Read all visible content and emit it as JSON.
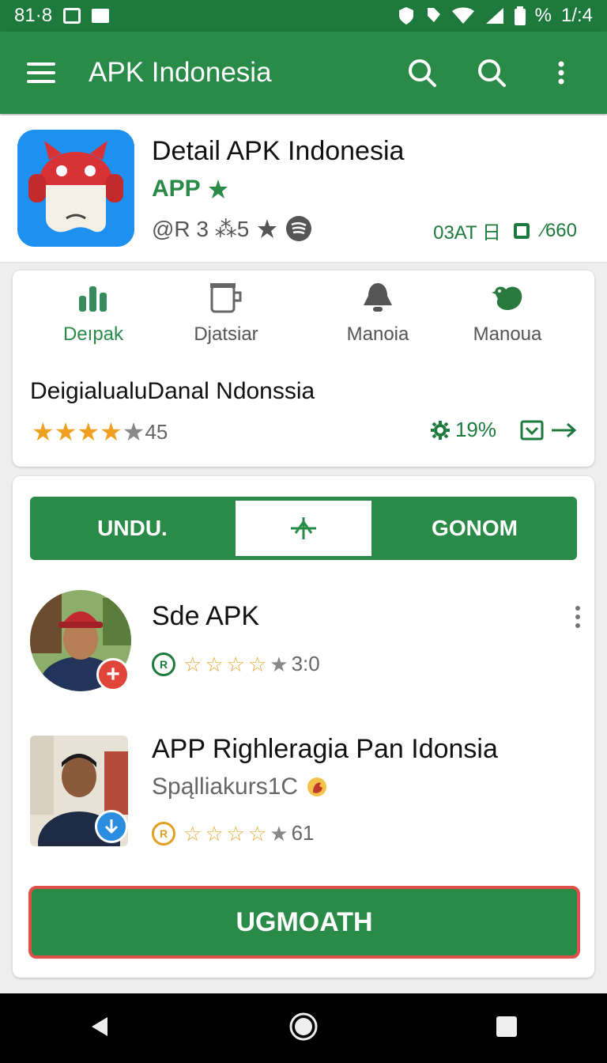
{
  "status": {
    "time": "81·8",
    "right": "%",
    "right_clock": "1/:4"
  },
  "appbar": {
    "title": "APK Indonesia"
  },
  "app": {
    "title": "Detail APK Indonesia",
    "subtitle": "APP",
    "meta": "@R 3 ⁂5",
    "meta_right_a": "03AT 日",
    "meta_right_b": "660"
  },
  "categories": [
    {
      "label": "Deıpak",
      "icon": "bar-chart-icon"
    },
    {
      "label": "Djatsiar",
      "icon": "cup-icon"
    },
    {
      "label": "Manoia",
      "icon": "bell-icon"
    },
    {
      "label": "Manoua",
      "icon": "rooster-icon"
    }
  ],
  "card1": {
    "title": "DeigialualuDanal Ndonssia",
    "rating_value": "45",
    "percent": "19%"
  },
  "tabs": {
    "left": "UNDU.",
    "right": "GONOM"
  },
  "list": [
    {
      "title": "Sde APK",
      "rating": "3:0"
    },
    {
      "title": "APP Righleragia Pan Idonsia",
      "subtitle": "Spąlliakurs1C",
      "rating": "61"
    }
  ],
  "big_button": {
    "label": "UGMOATH"
  },
  "colors": {
    "primary": "#2a8a48",
    "status": "#1e7a3c",
    "accent_red": "#e0504a",
    "star": "#f0a020"
  }
}
